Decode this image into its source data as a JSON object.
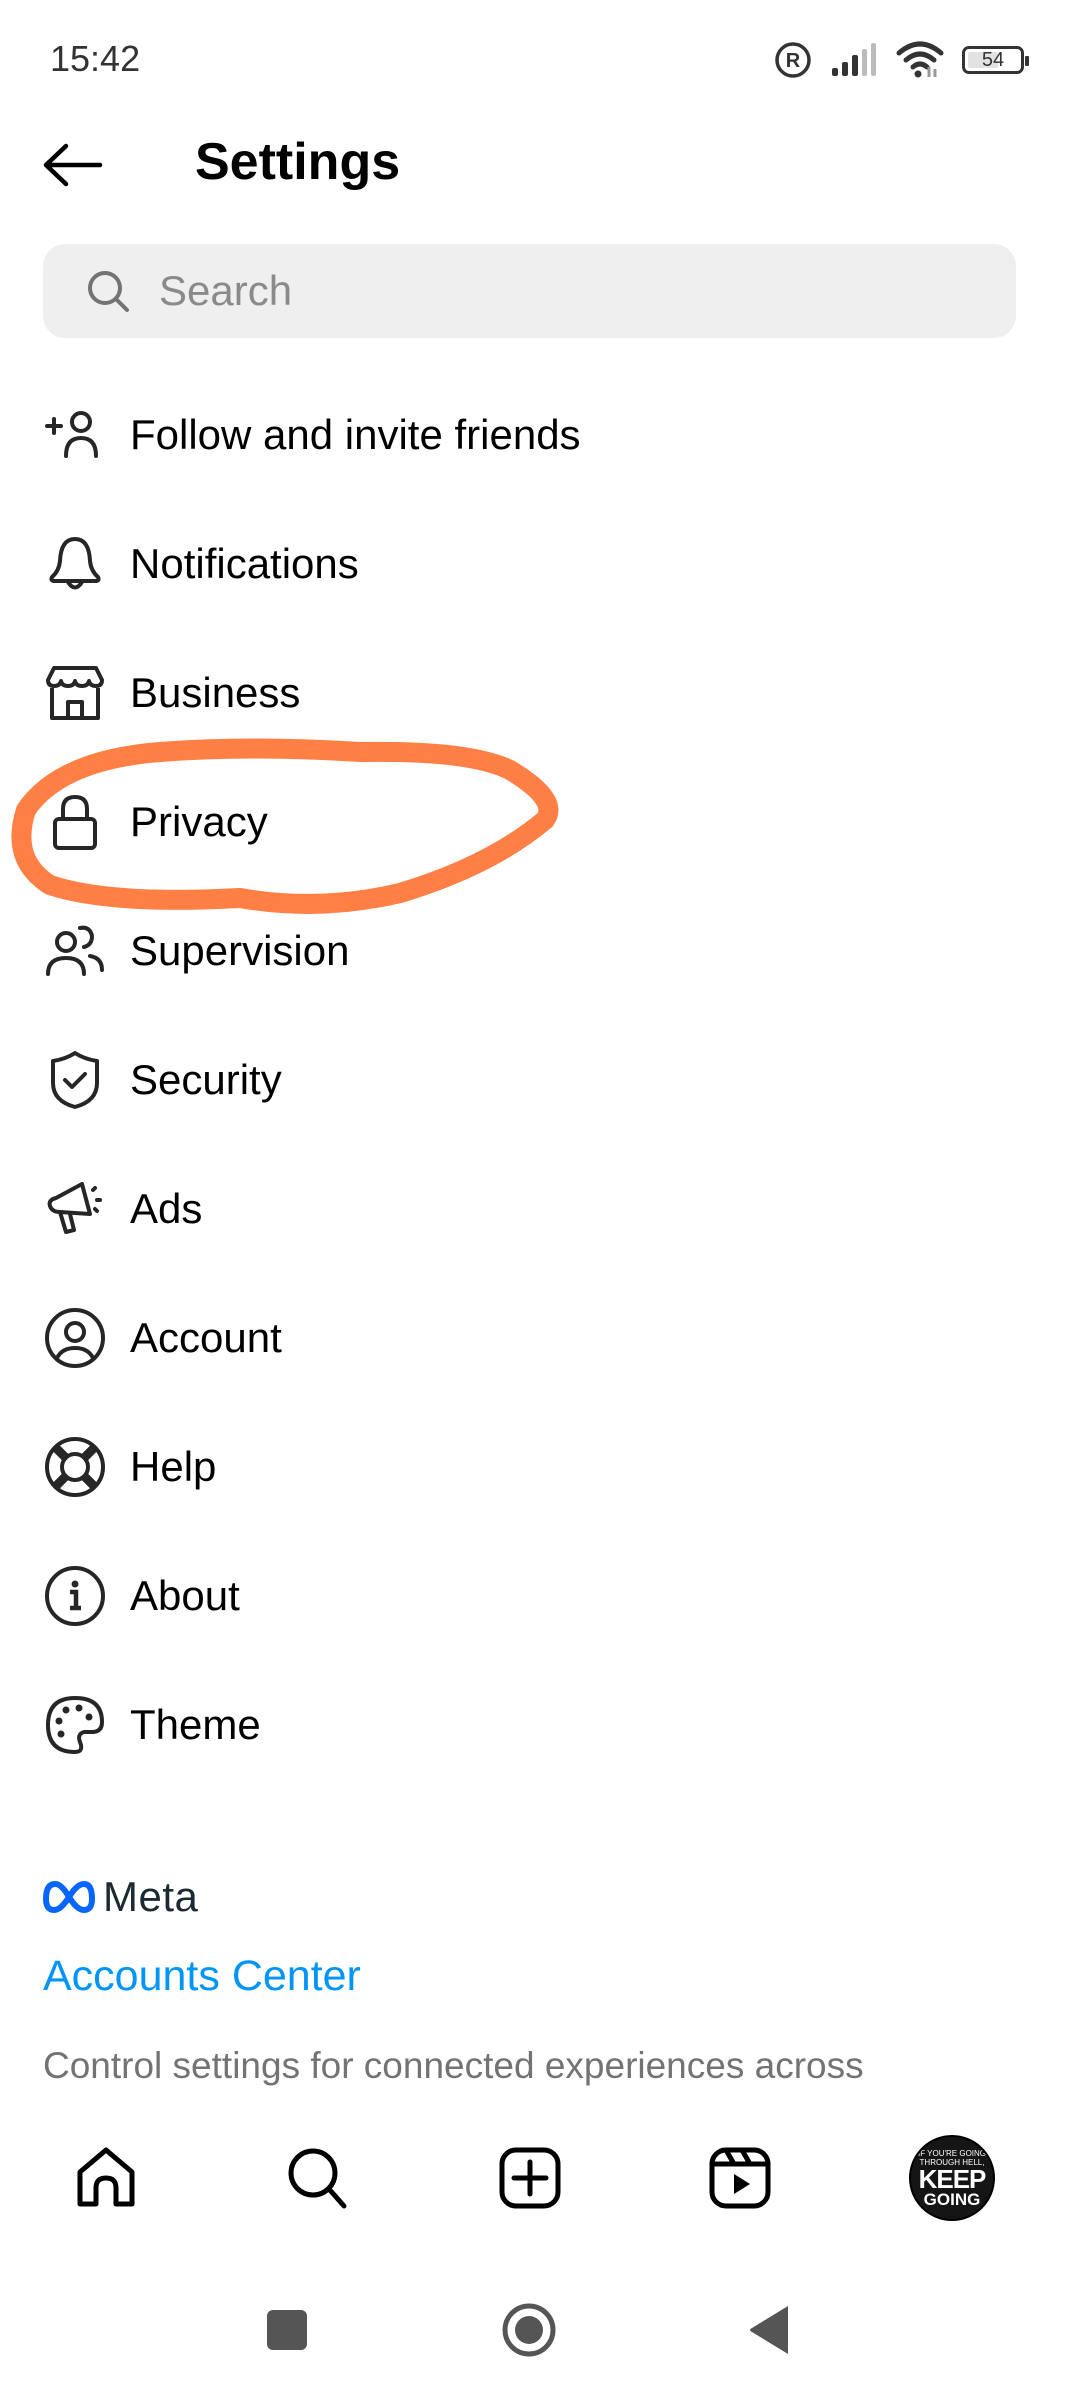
{
  "status_bar": {
    "time": "15:42",
    "icons": [
      "registered-icon",
      "cellular-signal-icon",
      "wifi-icon",
      "battery-icon"
    ],
    "battery_level": "54"
  },
  "header": {
    "back_icon": "arrow-left-icon",
    "title": "Settings"
  },
  "search": {
    "placeholder": "Search",
    "value": "",
    "icon": "search-icon"
  },
  "menu": {
    "items": [
      {
        "label": "Follow and invite friends",
        "icon": "add-person-icon"
      },
      {
        "label": "Notifications",
        "icon": "bell-icon"
      },
      {
        "label": "Business",
        "icon": "storefront-icon"
      },
      {
        "label": "Privacy",
        "icon": "lock-icon",
        "highlighted": true
      },
      {
        "label": "Supervision",
        "icon": "people-icon"
      },
      {
        "label": "Security",
        "icon": "shield-check-icon"
      },
      {
        "label": "Ads",
        "icon": "megaphone-icon"
      },
      {
        "label": "Account",
        "icon": "user-circle-icon"
      },
      {
        "label": "Help",
        "icon": "lifebuoy-icon"
      },
      {
        "label": "About",
        "icon": "info-icon"
      },
      {
        "label": "Theme",
        "icon": "palette-icon"
      }
    ]
  },
  "meta_section": {
    "logo_text": "Meta",
    "accounts_center_label": "Accounts Center",
    "description": "Control settings for connected experiences across"
  },
  "bottom_nav": {
    "items": [
      "home-icon",
      "search-icon",
      "create-post-icon",
      "reels-icon",
      "profile-avatar"
    ],
    "avatar_text": {
      "line1": "IF YOU'RE GOING",
      "line2": "THROUGH HELL,",
      "line3": "KEEP",
      "line4": "GOING"
    }
  },
  "system_nav": {
    "items": [
      "recents-button",
      "home-button",
      "back-button"
    ]
  },
  "colors": {
    "accent_link": "#0095f6",
    "annotation": "#ff7f45",
    "search_bg": "#efefef",
    "secondary_text": "#737373"
  }
}
